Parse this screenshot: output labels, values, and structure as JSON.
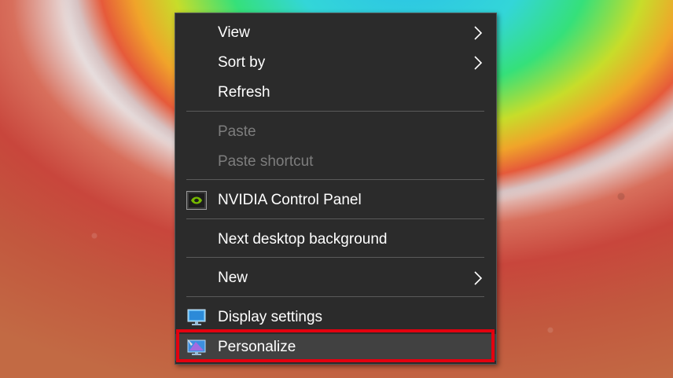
{
  "context_menu": {
    "items": [
      {
        "label": "View",
        "submenu": true
      },
      {
        "label": "Sort by",
        "submenu": true
      },
      {
        "label": "Refresh"
      },
      {
        "label": "Paste",
        "disabled": true
      },
      {
        "label": "Paste shortcut",
        "disabled": true
      },
      {
        "label": "NVIDIA Control Panel",
        "icon": "nvidia-icon"
      },
      {
        "label": "Next desktop background"
      },
      {
        "label": "New",
        "submenu": true
      },
      {
        "label": "Display settings",
        "icon": "display-settings-icon"
      },
      {
        "label": "Personalize",
        "icon": "personalize-icon",
        "highlighted": true
      }
    ]
  },
  "colors": {
    "menu_background": "#2b2b2b",
    "menu_text": "#ffffff",
    "disabled_text": "#7d7d7d",
    "highlight_border": "#e3000f"
  }
}
